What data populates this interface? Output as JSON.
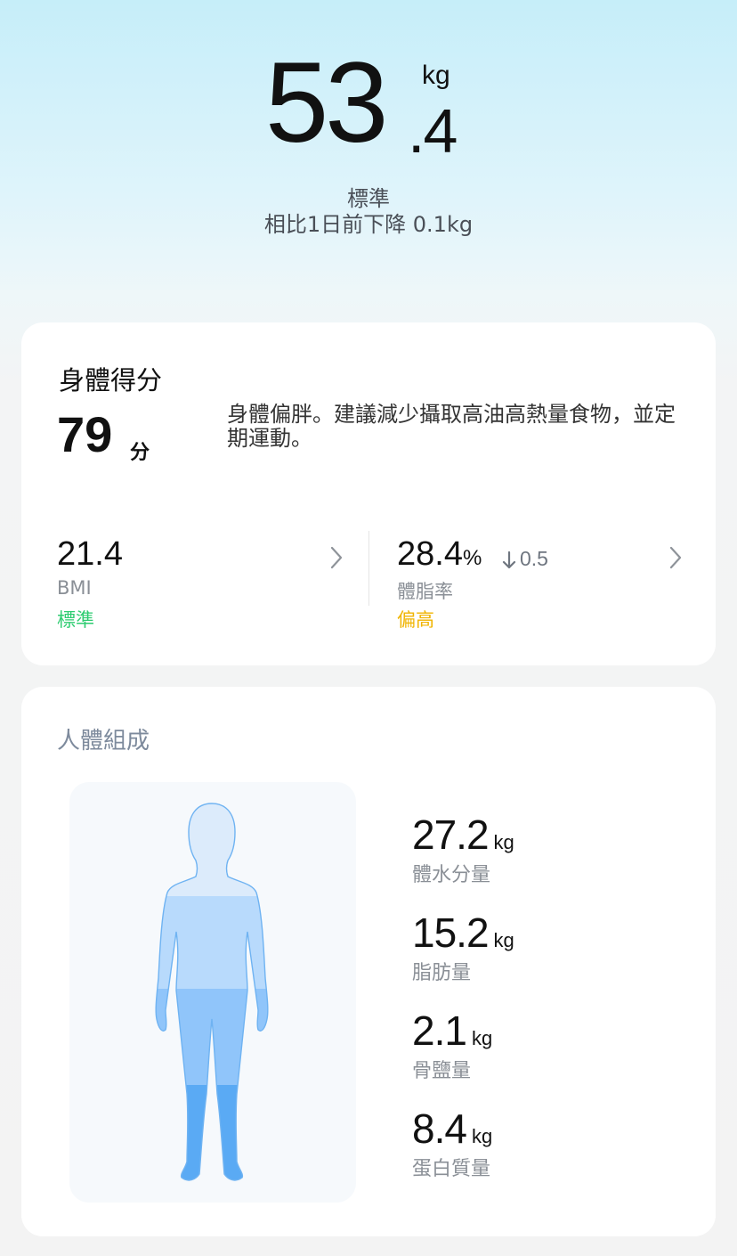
{
  "weight": {
    "integer": "53",
    "decimal": ".4",
    "unit": "kg",
    "status": "標準",
    "comparison": "相比1日前下降 0.1kg"
  },
  "score_card": {
    "title": "身體得分",
    "score": "79",
    "score_unit": "分",
    "advice": "身體偏胖。建議減少攝取高油高熱量食物，並定期運動。",
    "bmi": {
      "value": "21.4",
      "label": "BMI",
      "status": "標準",
      "status_color": "#2ecc71"
    },
    "body_fat": {
      "value": "28.4",
      "unit": "%",
      "delta": "0.5",
      "label": "體脂率",
      "status": "偏高",
      "status_color": "#f0b400"
    }
  },
  "composition": {
    "title": "人體組成",
    "items": [
      {
        "value": "27.2",
        "unit": "kg",
        "label": "體水分量"
      },
      {
        "value": "15.2",
        "unit": "kg",
        "label": "脂肪量"
      },
      {
        "value": "2.1",
        "unit": "kg",
        "label": "骨鹽量"
      },
      {
        "value": "8.4",
        "unit": "kg",
        "label": "蛋白質量"
      }
    ]
  },
  "colors": {
    "accent_light": "#d9ebfb",
    "accent_mid": "#a8d2fb",
    "accent_dark": "#5aaaf4"
  }
}
